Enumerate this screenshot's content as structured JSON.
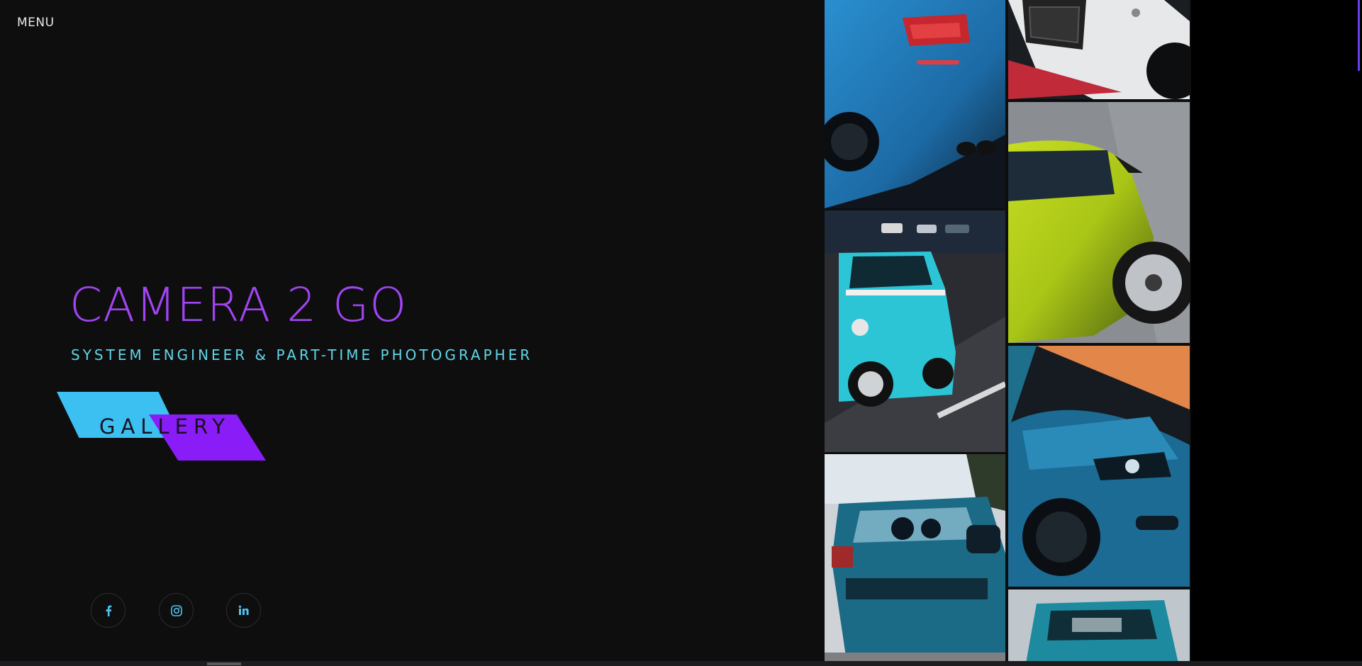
{
  "nav": {
    "menu_label": "MENU"
  },
  "hero": {
    "title": "CAMERA 2 GO",
    "subtitle": "SYSTEM ENGINEER & PART-TIME PHOTOGRAPHER",
    "gallery_label": "GALLERY"
  },
  "social": [
    {
      "name": "facebook",
      "icon": "facebook-icon"
    },
    {
      "name": "instagram",
      "icon": "instagram-icon"
    },
    {
      "name": "linkedin",
      "icon": "linkedin-icon"
    }
  ],
  "gallery": {
    "photos": [
      {
        "subject": "blue BMW rear with red tail light"
      },
      {
        "subject": "turquoise Trabant in parking lot"
      },
      {
        "subject": "blue BMW front on gravel"
      },
      {
        "subject": "white car front bumper"
      },
      {
        "subject": "yellow-green sports car"
      },
      {
        "subject": "blue BMW front at dusk"
      },
      {
        "subject": "turquoise car roof"
      }
    ]
  },
  "colors": {
    "accent_purple": "#a144f2",
    "accent_cyan": "#5fd6e8",
    "button_cyan": "#3cc0f2",
    "button_purple": "#8a1cf7",
    "background": "#0e0e0f"
  }
}
